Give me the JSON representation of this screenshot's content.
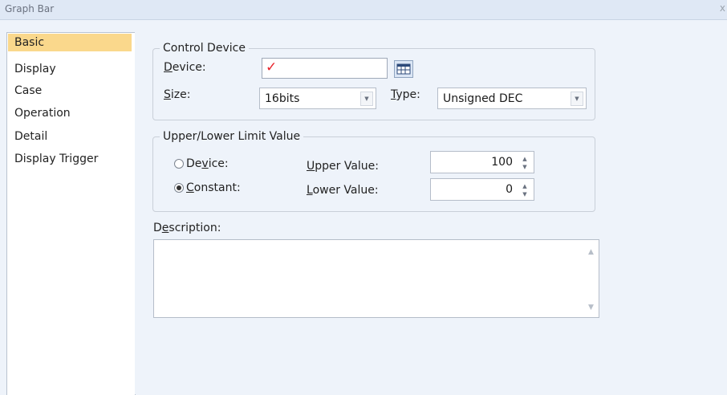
{
  "window": {
    "title": "Graph Bar",
    "close_glyph": "x"
  },
  "sidebar": {
    "items": [
      {
        "label": "Basic"
      },
      {
        "label": "Display"
      },
      {
        "label": "Case"
      },
      {
        "label": "Operation"
      },
      {
        "label": "Detail"
      },
      {
        "label": "Display Trigger"
      }
    ],
    "selected": "Basic"
  },
  "control_device": {
    "legend": "Control Device",
    "device_label": "Device:",
    "device_accel": "D",
    "device_rest": "evice:",
    "device_value": "",
    "device_status_icon": "red-checkmark-icon",
    "size_accel": "S",
    "size_rest": "ize:",
    "size_value": "16bits",
    "type_accel": "T",
    "type_rest": "ype:",
    "type_value": "Unsigned DEC"
  },
  "limit": {
    "legend": "Upper/Lower Limit Value",
    "device_radio_pre": "De",
    "device_radio_accel": "v",
    "device_radio_post": "ice:",
    "constant_radio_accel": "C",
    "constant_radio_post": "onstant:",
    "selected": "Constant",
    "upper_accel": "U",
    "upper_rest": "pper Value:",
    "upper_value": "100",
    "lower_accel": "L",
    "lower_rest": "ower Value:",
    "lower_value": "0"
  },
  "description": {
    "label_pre": "D",
    "label_accel": "e",
    "label_post": "scription:",
    "value": ""
  },
  "colors": {
    "selected_item_bg": "#fad88c",
    "checkmark": "#e8232b",
    "panel_bg": "#eef3fa"
  }
}
